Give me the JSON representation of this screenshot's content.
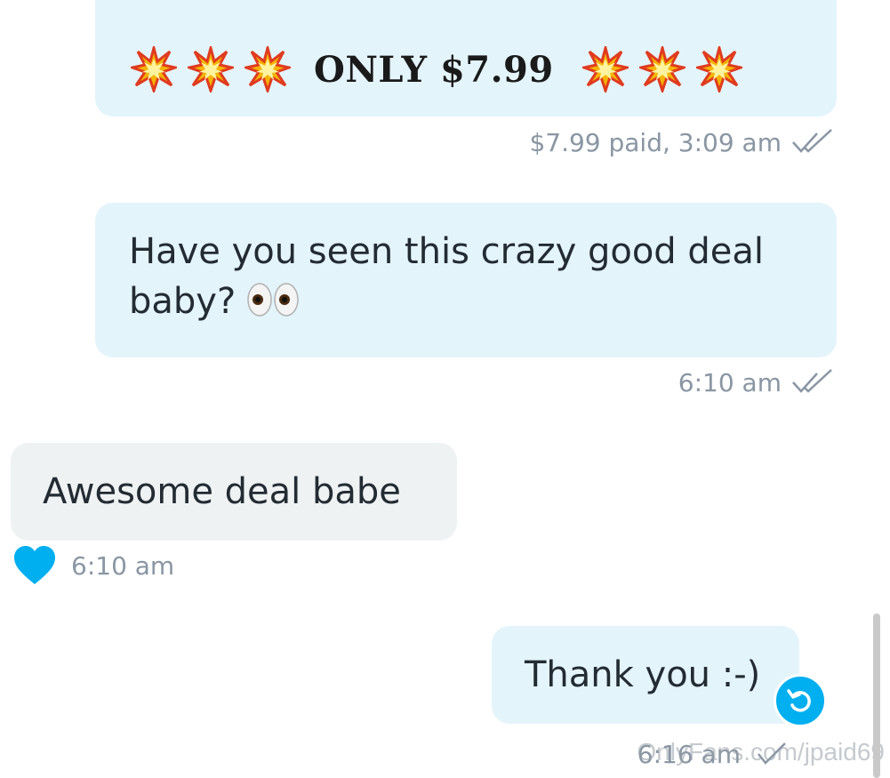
{
  "messages": [
    {
      "direction": "outgoing",
      "text": "ONLY $7.99",
      "emoji_left": [
        "collision-icon",
        "collision-icon",
        "collision-icon"
      ],
      "emoji_right": [
        "collision-icon",
        "collision-icon",
        "collision-icon"
      ],
      "meta": "$7.99 paid, 3:09 am",
      "status": "double-check-icon"
    },
    {
      "direction": "outgoing",
      "text": "Have you seen this crazy good deal baby?",
      "emoji": "eyes-icon",
      "meta": "6:10 am",
      "status": "double-check-icon"
    },
    {
      "direction": "incoming",
      "text": "Awesome deal babe",
      "meta": "6:10 am",
      "liked": true,
      "like_icon": "heart-icon"
    },
    {
      "direction": "outgoing",
      "text": "Thank you :-)",
      "meta": "6:16 am",
      "status": "check-icon",
      "action_icon": "undo-icon"
    }
  ],
  "watermark": "OnlyFans.com/jpaid69",
  "colors": {
    "outgoing_bubble": "#e4f4fb",
    "incoming_bubble": "#eff2f3",
    "accent": "#00aff0",
    "meta_text": "#8a96a3"
  }
}
